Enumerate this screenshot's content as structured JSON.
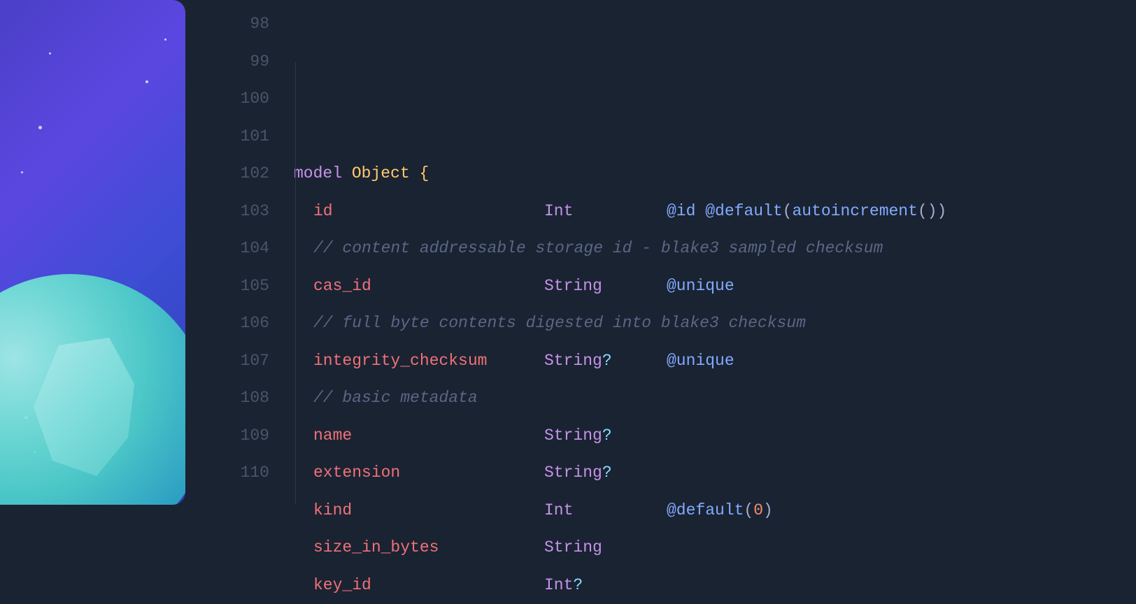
{
  "gutter": {
    "start": 98,
    "end": 110
  },
  "code": {
    "kw_model": "model",
    "class_name": "Object",
    "brace_open": "{",
    "lines": [
      {
        "num": 98,
        "kind": "blank"
      },
      {
        "num": 99,
        "kind": "decl"
      },
      {
        "num": 100,
        "kind": "field",
        "name": "id",
        "type": "Int",
        "attrs_kind": "id_default_autoinc"
      },
      {
        "num": 101,
        "kind": "comment",
        "text": "// content addressable storage id - blake3 sampled checksum"
      },
      {
        "num": 102,
        "kind": "field",
        "name": "cas_id",
        "type": "String",
        "attrs_kind": "unique"
      },
      {
        "num": 103,
        "kind": "comment",
        "text": "// full byte contents digested into blake3 checksum"
      },
      {
        "num": 104,
        "kind": "field",
        "name": "integrity_checksum",
        "type": "String",
        "optional": true,
        "attrs_kind": "unique"
      },
      {
        "num": 105,
        "kind": "comment",
        "text": "// basic metadata"
      },
      {
        "num": 106,
        "kind": "field",
        "name": "name",
        "type": "String",
        "optional": true
      },
      {
        "num": 107,
        "kind": "field",
        "name": "extension",
        "type": "String",
        "optional": true
      },
      {
        "num": 108,
        "kind": "field",
        "name": "kind",
        "type": "Int",
        "attrs_kind": "default_zero"
      },
      {
        "num": 109,
        "kind": "field",
        "name": "size_in_bytes",
        "type": "String"
      },
      {
        "num": 110,
        "kind": "field",
        "name": "key_id",
        "type": "Int",
        "optional": true
      }
    ],
    "attrs": {
      "at_id": "@id",
      "at_default": "@default",
      "at_unique": "@unique",
      "fn_autoincrement": "autoincrement",
      "num_zero": "0"
    }
  }
}
